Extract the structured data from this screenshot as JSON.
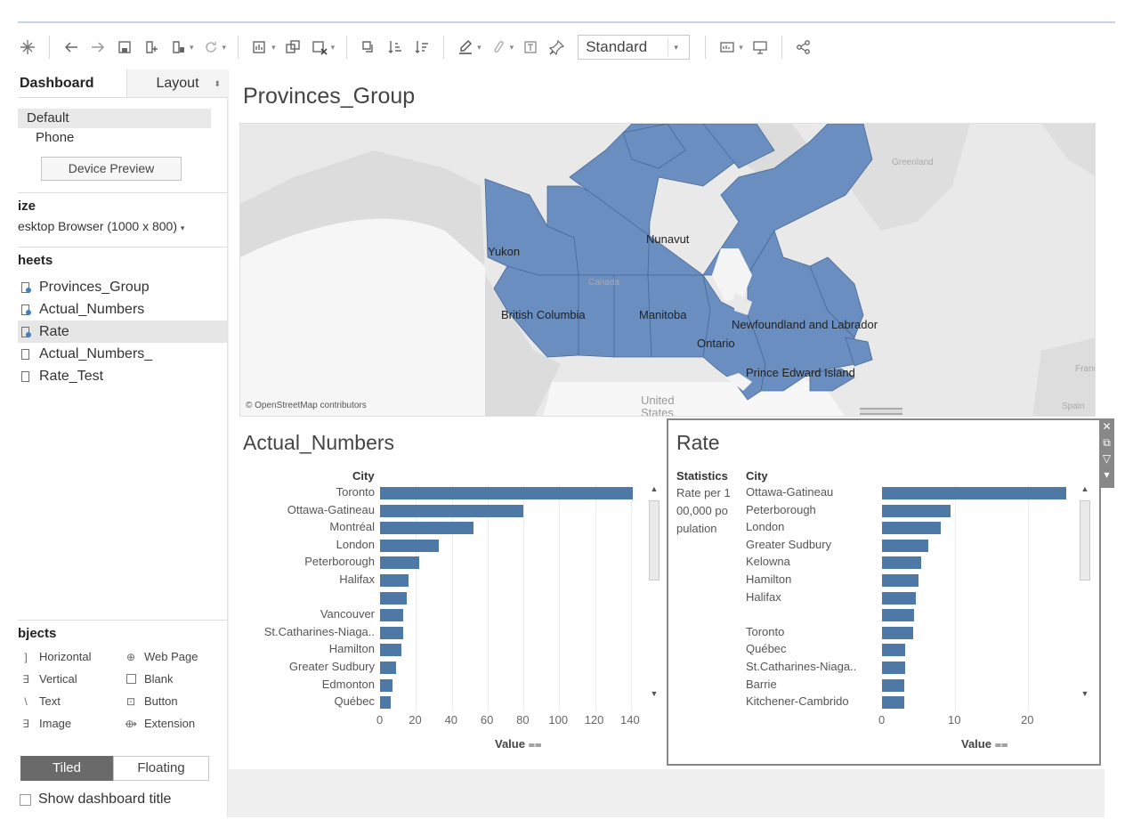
{
  "toolbar": {
    "view_select": "Standard"
  },
  "left_pane": {
    "tabs": {
      "dashboard": "Dashboard",
      "layout": "Layout"
    },
    "devices": {
      "default": "Default",
      "phone": "Phone",
      "preview_button": "Device Preview"
    },
    "size": {
      "heading": "ize",
      "value": "esktop Browser (1000 x 800)"
    },
    "sheets": {
      "heading": "heets",
      "items": [
        "Provinces_Group",
        "Actual_Numbers",
        "Rate",
        "Actual_Numbers_",
        "Rate_Test"
      ]
    },
    "objects": {
      "heading": "bjects",
      "items": [
        "Horizontal",
        "Web Page",
        "Vertical",
        "Blank",
        "Text",
        "Button",
        "Image",
        "Extension"
      ]
    },
    "tiled": "Tiled",
    "floating": "Floating",
    "show_title": "Show dashboard title"
  },
  "dashboard": {
    "title": "Provinces_Group",
    "map": {
      "labels": {
        "yukon": "Yukon",
        "nunavut": "Nunavut",
        "bc": "British Columbia",
        "manitoba": "Manitoba",
        "ontario": "Ontario",
        "nl": "Newfoundland and Labrador",
        "pei": "Prince Edward Island",
        "canada": "Canada",
        "greenland": "Greenland",
        "us1": "United",
        "us2": "States",
        "france": "Franc",
        "spain": "Spain"
      },
      "credit": "© OpenStreetMap contributors",
      "fill_color": "#6a8ebf"
    },
    "actual_numbers": {
      "title": "Actual_Numbers",
      "dimension_header": "City",
      "axis_title": "Value",
      "ticks": [
        "0",
        "20",
        "40",
        "60",
        "80",
        "100",
        "120",
        "140"
      ]
    },
    "rate": {
      "title": "Rate",
      "stat_header": "Statistics",
      "dimension_header": "City",
      "stat_lines": [
        "Rate per 1",
        "00,000 po",
        "pulation"
      ],
      "axis_title": "Value",
      "ticks": [
        "0",
        "10",
        "20"
      ]
    }
  },
  "chart_data": [
    {
      "type": "bar",
      "title": "Actual_Numbers",
      "ylabel": "City",
      "xlabel": "Value",
      "xlim": [
        0,
        140
      ],
      "categories": [
        "Toronto",
        "Ottawa-Gatineau",
        "Montréal",
        "London",
        "Peterborough",
        "Halifax",
        "",
        "Vancouver",
        "St.Catharines-Niaga..",
        "Hamilton",
        "Greater Sudbury",
        "Edmonton",
        "Québec"
      ],
      "values": [
        141,
        80,
        52,
        33,
        22,
        16,
        15,
        13,
        13,
        12,
        9,
        7,
        6
      ]
    },
    {
      "type": "bar",
      "title": "Rate",
      "ylabel": "City",
      "xlabel": "Value",
      "xlim": [
        0,
        25
      ],
      "categories": [
        "Ottawa-Gatineau",
        "Peterborough",
        "London",
        "Greater Sudbury",
        "Kelowna",
        "Hamilton",
        "Halifax",
        "",
        "Toronto",
        "Québec",
        "St.Catharines-Niaga..",
        "Barrie",
        "Kitchener-Cambrido"
      ],
      "values": [
        25.2,
        9.4,
        8.0,
        6.4,
        5.4,
        5.0,
        4.6,
        4.4,
        4.3,
        3.2,
        3.2,
        3.1,
        3.0
      ]
    }
  ]
}
